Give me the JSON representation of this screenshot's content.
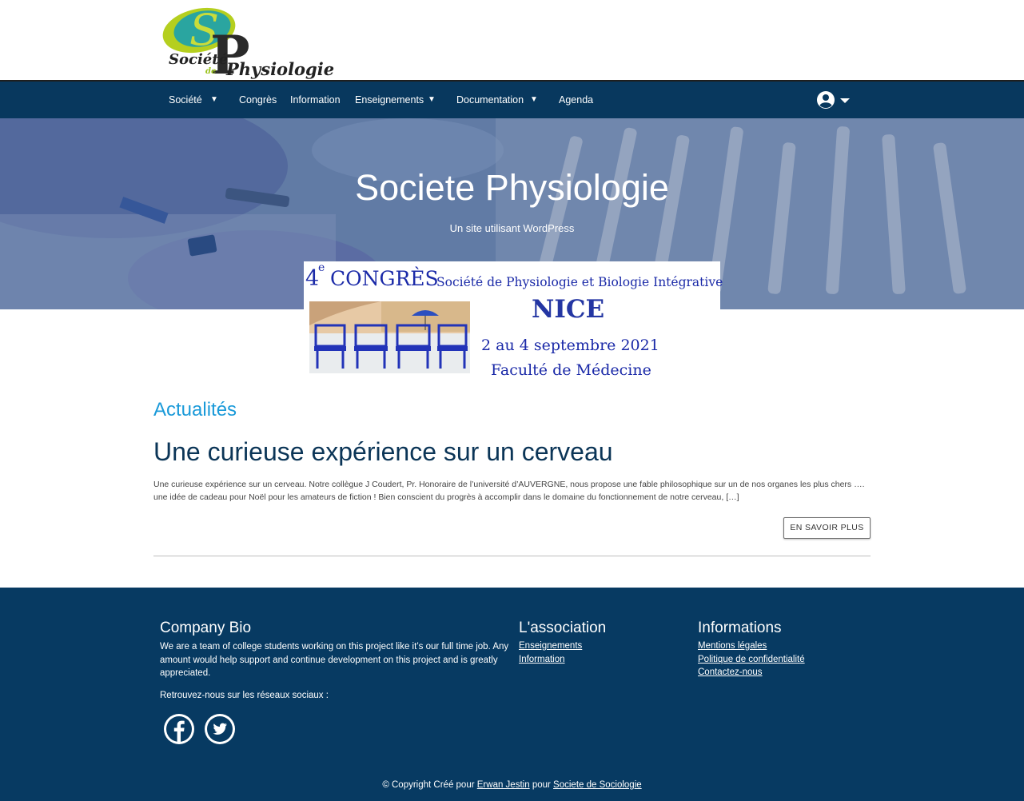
{
  "logo": {
    "text_societe": "Société",
    "text_de": "de",
    "text_physiologie": "Physiologie"
  },
  "nav": {
    "items": [
      "Société",
      "Congrès",
      "Information",
      "Enseignements",
      "Documentation",
      "Agenda"
    ]
  },
  "hero": {
    "title": "Societe Physiologie",
    "subtitle": "Un site utilisant WordPress"
  },
  "banner": {
    "number": "4",
    "superscript": "e",
    "congres": "CONGRÈS",
    "society": "Société de Physiologie et Biologie Intégrative",
    "city": "NICE",
    "dates": "2 au 4 septembre 2021",
    "venue": "Faculté de Médecine"
  },
  "main": {
    "section_title": "Actualités",
    "post": {
      "title": "Une curieuse expérience sur un cerveau",
      "excerpt": "Une curieuse expérience sur un cerveau. Notre collègue J Coudert, Pr. Honoraire de l’université d’AUVERGNE, nous propose une fable philosophique sur un de nos organes les plus chers …. une idée de cadeau pour Noël pour les amateurs de fiction ! Bien conscient du progrès à accomplir dans le domaine du fonctionnement de notre cerveau, […]",
      "more_label": "EN SAVOIR PLUS"
    }
  },
  "footer": {
    "bio": {
      "heading": "Company Bio",
      "text": "We are a team of college students working on this project like it’s our full time job. Any amount would help support and continue development on this project and is greatly appreciated.",
      "social_label": "Retrouvez-nous sur les réseaux sociaux :"
    },
    "association": {
      "heading": "L'association",
      "links": [
        "Enseignements",
        "Information"
      ]
    },
    "informations": {
      "heading": "Informations",
      "links": [
        "Mentions légales",
        "Politique de confidentialité",
        "Contactez-nous"
      ]
    },
    "copyright": {
      "prefix": "© Copyright Créé pour",
      "author": "Erwan Jestin",
      "middle": "pour",
      "site": "Societe de Sociologie"
    }
  },
  "colors": {
    "nav_bg": "#08385e",
    "footer_bg": "#073a62",
    "accent": "#1a9ad9",
    "post_title": "#0b3557",
    "banner_text": "#1b2aa8"
  }
}
